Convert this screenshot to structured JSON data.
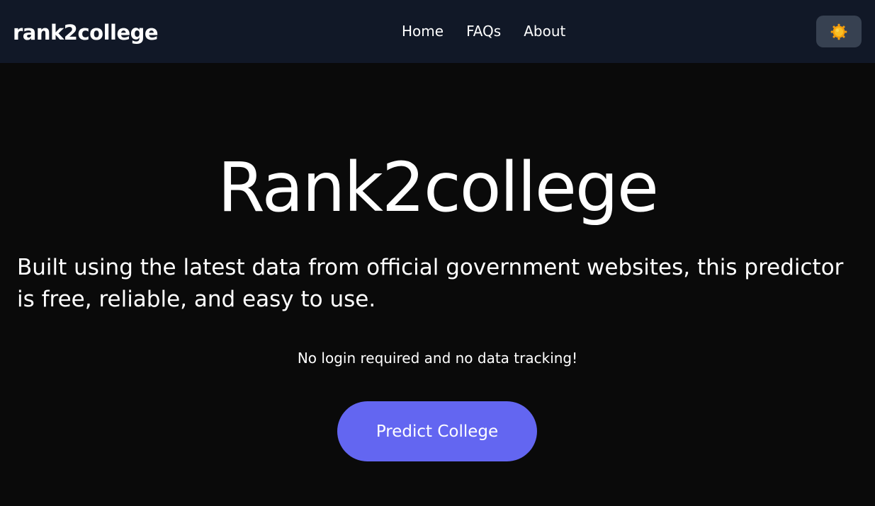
{
  "header": {
    "brand": "rank2college",
    "nav": [
      "Home",
      "FAQs",
      "About"
    ],
    "theme_toggle_icon": "sun-icon",
    "colors": {
      "background": "#111827",
      "toggle_bg": "#374151",
      "sun": "#f59e0b"
    }
  },
  "hero": {
    "title": "Rank2college",
    "description": "Built using the latest data from official government websites, this predictor is free, reliable, and easy to use.",
    "note": "No login required and no data tracking!",
    "cta_label": "Predict College",
    "colors": {
      "background": "#0a0a0a",
      "cta": "#6366f1"
    }
  }
}
